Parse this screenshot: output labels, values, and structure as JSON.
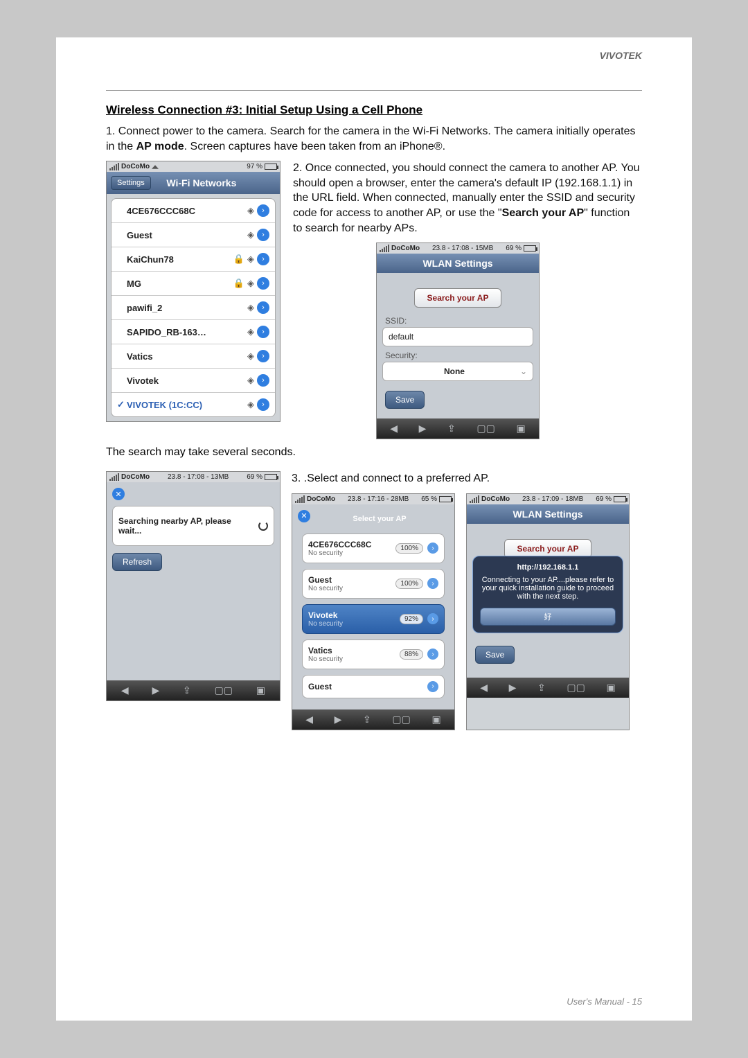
{
  "brand": "VIVOTEK",
  "section_title": "Wireless Connection #3: Initial Setup Using a Cell Phone",
  "step1_a": "1. Connect power to the camera. Search for the camera in the Wi-Fi Networks. The camera initially operates in the ",
  "step1_b": "AP mode",
  "step1_c": ". Screen captures have been taken from an iPhone®.",
  "step2_a": "2. Once connected, you should connect the camera to another AP. You should open a browser, enter the camera's default IP (192.168.1.1) in the URL field. When connected, manually enter the SSID and security code for access to another AP, or use the \"",
  "step2_b": "Search your AP",
  "step2_c": "\" function to search for nearby APs.",
  "search_caption": "The search may take several seconds.",
  "step3": "3. .Select and connect to a preferred AP.",
  "footer": "User's Manual - 15",
  "wifi_panel": {
    "status": {
      "carrier": "DoCoMo",
      "battery": "97 %"
    },
    "back": "Settings",
    "title": "Wi-Fi Networks",
    "rows": [
      {
        "name": "4CE676CCC68C",
        "locked": false,
        "selected": false
      },
      {
        "name": "Guest",
        "locked": false,
        "selected": false
      },
      {
        "name": "KaiChun78",
        "locked": true,
        "selected": false
      },
      {
        "name": "MG",
        "locked": true,
        "selected": false
      },
      {
        "name": "pawifi_2",
        "locked": false,
        "selected": false
      },
      {
        "name": "SAPIDO_RB-163…",
        "locked": false,
        "selected": false
      },
      {
        "name": "Vatics",
        "locked": false,
        "selected": false
      },
      {
        "name": "Vivotek",
        "locked": false,
        "selected": false
      },
      {
        "name": "VIVOTEK (1C:CC)",
        "locked": false,
        "selected": true
      }
    ]
  },
  "wlan_panel": {
    "status": {
      "carrier": "DoCoMo",
      "center": "23.8 - 17:08 - 15MB",
      "battery": "69 %"
    },
    "title": "WLAN Settings",
    "search_btn": "Search your AP",
    "ssid_label": "SSID:",
    "ssid_value": "default",
    "security_label": "Security:",
    "security_value": "None",
    "save": "Save"
  },
  "searching_panel": {
    "status": {
      "carrier": "DoCoMo",
      "center": "23.8 - 17:08 - 13MB",
      "battery": "69 %"
    },
    "msg": "Searching nearby AP, please wait...",
    "refresh": "Refresh"
  },
  "select_panel": {
    "status": {
      "carrier": "DoCoMo",
      "center": "23.8 - 17:16 - 28MB",
      "battery": "65 %"
    },
    "title": "Select your AP",
    "rows": [
      {
        "name": "4CE676CCC68C",
        "sub": "No security",
        "pct": "100%",
        "sel": false
      },
      {
        "name": "Guest",
        "sub": "No security",
        "pct": "100%",
        "sel": false
      },
      {
        "name": "Vivotek",
        "sub": "No security",
        "pct": "92%",
        "sel": true
      },
      {
        "name": "Vatics",
        "sub": "No security",
        "pct": "88%",
        "sel": false
      },
      {
        "name": "Guest",
        "sub": "",
        "pct": "",
        "sel": false
      }
    ]
  },
  "connecting_panel": {
    "status": {
      "carrier": "DoCoMo",
      "center": "23.8 - 17:09 - 18MB",
      "battery": "69 %"
    },
    "title": "WLAN Settings",
    "search_btn": "Search your AP",
    "popup_title": "http://192.168.1.1",
    "popup_body": "Connecting to your AP....please refer to your quick installation guide to proceed with the next step.",
    "popup_ok": "好",
    "save": "Save"
  }
}
